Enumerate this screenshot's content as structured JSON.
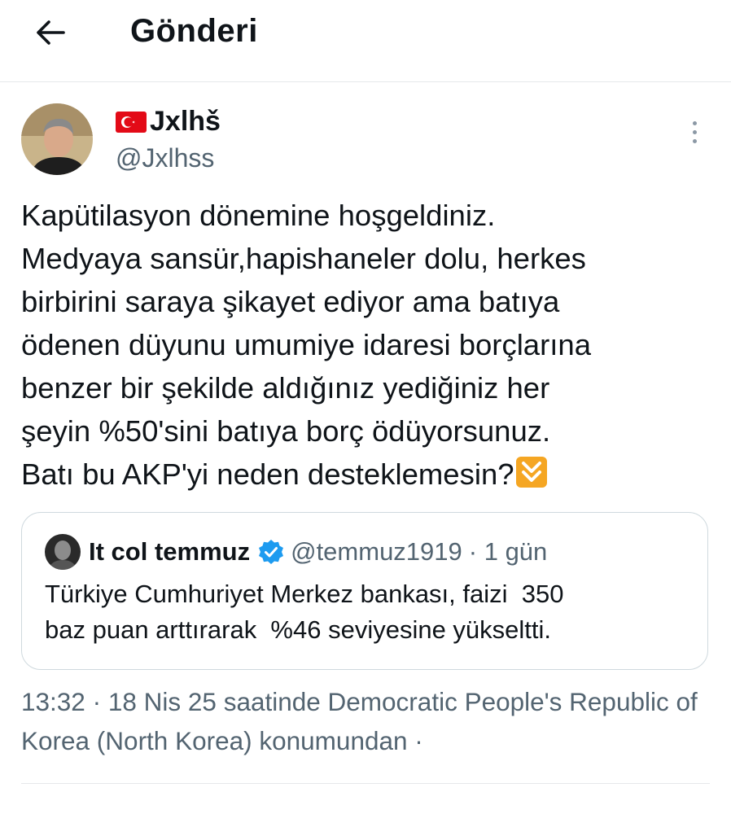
{
  "header": {
    "title": "Gönderi",
    "back_icon": "arrow-left-icon"
  },
  "tweet": {
    "display_name": "Jxlhš",
    "name_prefix_icon": "turkey-flag-icon",
    "handle": "@Jxlhss",
    "text": "Kapütilasyon dönemine hoşgeldiniz.\nMedyaya sansür,hapishaneler dolu, herkes\nbirbirini saraya şikayet ediyor ama batıya\nödenen düyunu umumiye idaresi borçlarına\nbenzer bir şekilde aldığınız yediğiniz her\nşeyin %50'sini batıya borç ödüyorsunuz.\nBatı bu AKP'yi neden desteklemesin?",
    "trailing_emoji": "double-down-arrow-emoji"
  },
  "quote": {
    "display_name": "It col temmuz",
    "verified": true,
    "handle": "@temmuz1919",
    "time": "· 1 gün",
    "text": "Türkiye Cumhuriyet Merkez bankası, faizi  350\nbaz puan arttırarak  %46 seviyesine yükseltti."
  },
  "meta": {
    "time": "13:32",
    "date": "· 18 Nis 25",
    "location_text": "saatinde Democratic People's Republic of Korea (North Korea) konumundan",
    "trailing": "·"
  },
  "colors": {
    "text": "#0f1419",
    "secondary": "#536471",
    "border": "#cfd9de",
    "verified": "#1d9bf0",
    "flag": "#e30a17"
  }
}
